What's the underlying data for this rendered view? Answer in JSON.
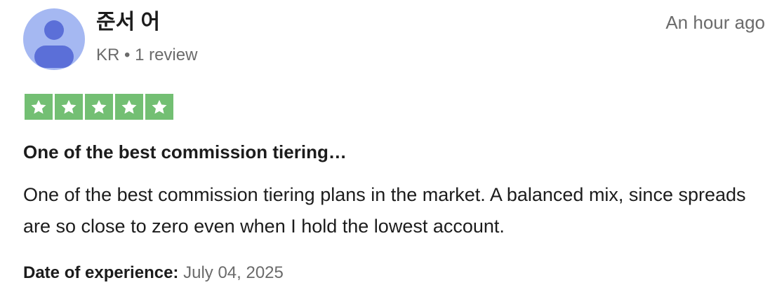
{
  "review": {
    "author": {
      "name": "준서 어",
      "meta": "KR • 1 review",
      "avatar_icon": "user-icon"
    },
    "timestamp": "An hour ago",
    "rating": {
      "stars": 5,
      "max": 5,
      "color": "#73bf73",
      "icon": "star-icon"
    },
    "title": "One of the best commission tiering…",
    "body": "One of the best commission tiering plans in the market. A balanced mix, since spreads are so close to zero even when I hold the lowest account.",
    "experience": {
      "label": "Date of experience:",
      "date": "July 04, 2025"
    }
  }
}
